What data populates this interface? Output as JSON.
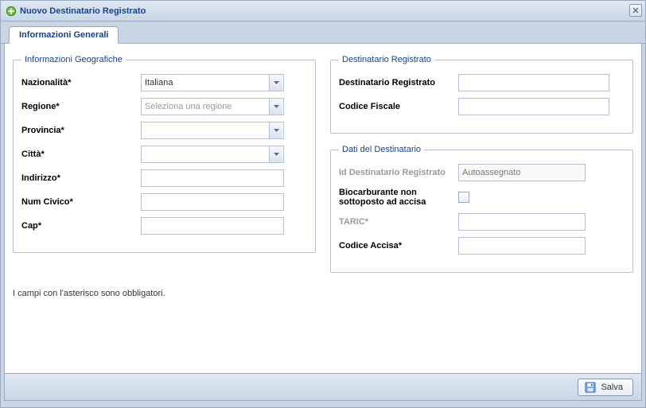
{
  "window": {
    "title": "Nuovo Destinatario Registrato"
  },
  "tabs": {
    "general": "Informazioni Generali"
  },
  "geo": {
    "legend": "Informazioni Geografiche",
    "nazionalita_label": "Nazionalità*",
    "nazionalita_value": "Italiana",
    "regione_label": "Regione*",
    "regione_placeholder": "Seleziona una regione",
    "provincia_label": "Provincia*",
    "citta_label": "Città*",
    "indirizzo_label": "Indirizzo*",
    "numcivico_label": "Num Civico*",
    "cap_label": "Cap*"
  },
  "dest": {
    "legend": "Destinatario Registrato",
    "dest_label": "Destinatario Registrato",
    "cf_label": "Codice Fiscale"
  },
  "dati": {
    "legend": "Dati del Destinatario",
    "id_label": "Id Destinatario Registrato",
    "id_placeholder": "Autoassegnato",
    "bio_label": "Biocarburante non sottoposto ad accisa",
    "taric_label": "TARIC*",
    "accisa_label": "Codice Accisa*"
  },
  "note": "I campi con l'asterisco sono obbligatori.",
  "footer": {
    "save": "Salva"
  }
}
